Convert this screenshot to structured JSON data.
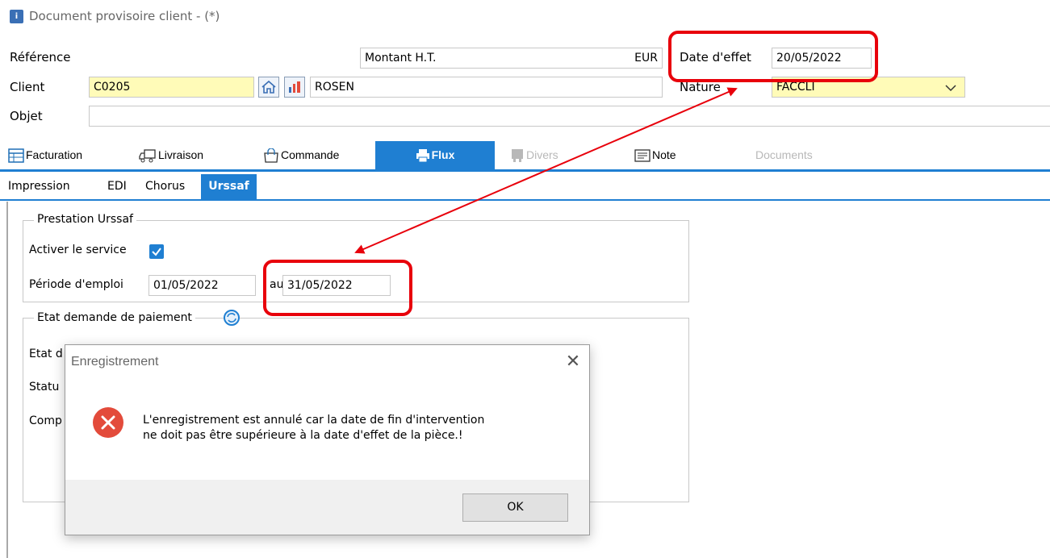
{
  "window": {
    "title": "Document provisoire client -  (*)"
  },
  "header": {
    "reference_label": "Référence",
    "reference_value": "",
    "montant_label": "Montant H.T.",
    "currency": "EUR",
    "date_effet_label": "Date d'effet",
    "date_effet_value": "20/05/2022",
    "client_label": "Client",
    "client_code": "C0205",
    "client_name": "ROSEN",
    "nature_label": "Nature",
    "nature_value": "FACCLI",
    "objet_label": "Objet",
    "objet_value": ""
  },
  "tabs": [
    {
      "label": "Facturation",
      "icon": "invoice-icon"
    },
    {
      "label": "Livraison",
      "icon": "delivery-icon"
    },
    {
      "label": "Commande",
      "icon": "shopping-bag-icon"
    },
    {
      "label": "Flux",
      "icon": "printer-icon",
      "active": true
    },
    {
      "label": "Divers",
      "icon": "misc-icon",
      "disabled": true
    },
    {
      "label": "Note",
      "icon": "note-icon"
    },
    {
      "label": "Documents",
      "disabled": true
    }
  ],
  "subtabs": [
    {
      "label": "Impression"
    },
    {
      "label": "EDI"
    },
    {
      "label": "Chorus"
    },
    {
      "label": "Urssaf",
      "active": true
    }
  ],
  "prestation": {
    "title": "Prestation Urssaf",
    "activer_label": "Activer le service",
    "activer_checked": true,
    "periode_label": "Période d'emploi",
    "periode_from": "01/05/2022",
    "au_label": "au",
    "periode_to": "31/05/2022"
  },
  "etat": {
    "title": "Etat demande de paiement",
    "row1_label": "Etat d",
    "row2_label": "Statu",
    "row3_label": "Comp"
  },
  "dialog": {
    "title": "Enregistrement",
    "message": "L'enregistrement est annulé car la date de fin d'intervention\nne doit pas être supérieure à la date d'effet de la pièce.!",
    "ok_label": "OK"
  },
  "colors": {
    "accent": "#1f7fd2",
    "highlight_red": "#e8000b",
    "required_field": "#fffbb8",
    "error_icon": "#e34b3b"
  }
}
